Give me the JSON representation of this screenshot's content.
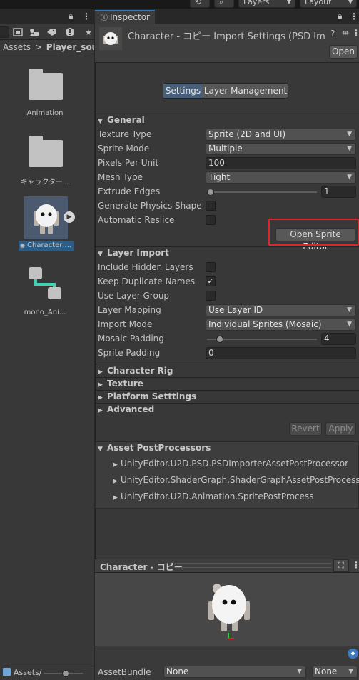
{
  "top_toolbar": {
    "layers_label": "Layers",
    "layout_label": "Layout"
  },
  "project": {
    "breadcrumb": {
      "root": "Assets",
      "separator": ">",
      "current": "Player_sourc"
    },
    "items": [
      {
        "label": "Animation",
        "icon": "folder-icon"
      },
      {
        "label": "キャラクター...",
        "icon": "folder-icon"
      },
      {
        "label": "Character ...",
        "icon": "sprite-character-icon",
        "selected": true
      },
      {
        "label": "mono_Ani...",
        "icon": "animator-controller-icon"
      }
    ],
    "footer_label": "Assets/"
  },
  "inspector": {
    "tab_label": "Inspector",
    "header": {
      "title": "Character - コピー Import Settings (PSD Impor",
      "open_button": "Open"
    },
    "mode_tabs": [
      "Settings",
      "Layer Management"
    ],
    "active_mode": "Settings",
    "general": {
      "title": "General",
      "texture_type_label": "Texture Type",
      "texture_type_value": "Sprite (2D and UI)",
      "sprite_mode_label": "Sprite Mode",
      "sprite_mode_value": "Multiple",
      "ppu_label": "Pixels Per Unit",
      "ppu_value": "100",
      "mesh_type_label": "Mesh Type",
      "mesh_type_value": "Tight",
      "extrude_label": "Extrude Edges",
      "extrude_value": "1",
      "extrude_fraction": 0.03,
      "physics_shape_label": "Generate Physics Shape",
      "physics_shape_checked": false,
      "auto_reslice_label": "Automatic Reslice",
      "auto_reslice_checked": false,
      "open_sprite_editor": "Open Sprite Editor"
    },
    "layer_import": {
      "title": "Layer Import",
      "hidden_layers_label": "Include Hidden Layers",
      "hidden_layers_checked": false,
      "keep_duplicate_label": "Keep Duplicate Names",
      "keep_duplicate_checked": true,
      "use_layer_group_label": "Use Layer Group",
      "use_layer_group_checked": false,
      "layer_mapping_label": "Layer Mapping",
      "layer_mapping_value": "Use Layer ID",
      "import_mode_label": "Import Mode",
      "import_mode_value": "Individual Sprites (Mosaic)",
      "mosaic_padding_label": "Mosaic Padding",
      "mosaic_padding_value": "4",
      "mosaic_padding_fraction": 0.12,
      "sprite_padding_label": "Sprite Padding",
      "sprite_padding_value": "0"
    },
    "collapsed_sections": [
      "Character Rig",
      "Texture",
      "Platform Setttings",
      "Advanced"
    ],
    "revert_label": "Revert",
    "apply_label": "Apply",
    "postprocessors": {
      "title": "Asset PostProcessors",
      "items": [
        "UnityEditor.U2D.PSD.PSDImporterAssetPostProcessor",
        "UnityEditor.ShaderGraph.ShaderGraphAssetPostProcessor",
        "UnityEditor.U2D.Animation.SpritePostProcess"
      ]
    },
    "preview": {
      "title": "Character - コピー"
    },
    "asset_bundle": {
      "label": "AssetBundle",
      "name_value": "None",
      "variant_value": "None"
    }
  },
  "colors": {
    "accent": "#3a79bb",
    "highlight_box": "#e0242b",
    "background": "#383838"
  }
}
